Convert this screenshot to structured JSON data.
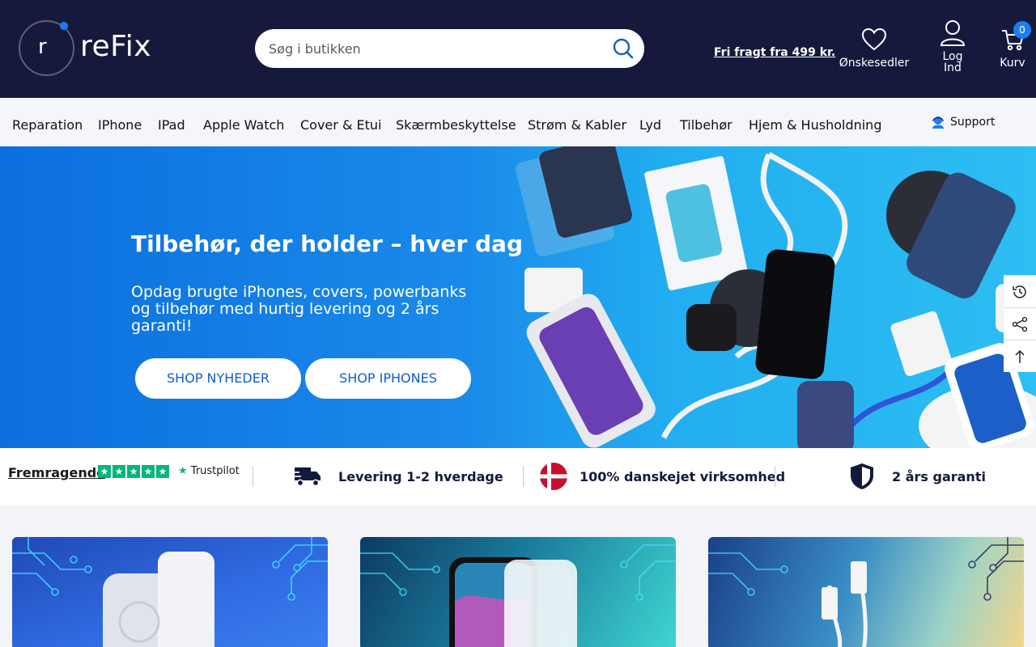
{
  "header": {
    "logo_mark": "r",
    "logo_text": "reFix",
    "search_placeholder": "Søg i butikken",
    "free_shipping": "Fri fragt fra 499 kr.",
    "wishlist_label": "Ønskesedler",
    "login_label": "Log Ind",
    "cart_label": "Kurv",
    "cart_count": "0"
  },
  "nav": {
    "items": [
      "Reparation",
      "IPhone",
      "IPad",
      "Apple Watch",
      "Cover & Etui",
      "Skærmbeskyttelse",
      "Strøm & Kabler",
      "Lyd",
      "Tilbehør",
      "Hjem & Husholdning"
    ],
    "support": "Support"
  },
  "hero": {
    "title": "Tilbehør, der holder – hver dag",
    "subtitle": "Opdag brugte iPhones, covers, powerbanks og tilbehør med hurtig levering og 2 års garanti!",
    "btn_new": "SHOP NYHEDER",
    "btn_iphones": "SHOP IPHONES"
  },
  "trust": {
    "rating_word": "Fremragende",
    "trustpilot": "Trustpilot",
    "delivery": "Levering 1-2 hverdage",
    "danish": "100% danskejet virksomhed",
    "warranty": "2 års garanti"
  },
  "icons": [
    "search-icon",
    "heart-icon",
    "user-icon",
    "cart-icon",
    "headset-icon",
    "history-icon",
    "share-icon",
    "arrow-up-icon",
    "truck-icon",
    "danish-flag-icon",
    "shield-icon"
  ],
  "colors": {
    "header_bg": "#151a3c",
    "accent": "#1d7df0",
    "trustpilot_green": "#00b67a"
  }
}
